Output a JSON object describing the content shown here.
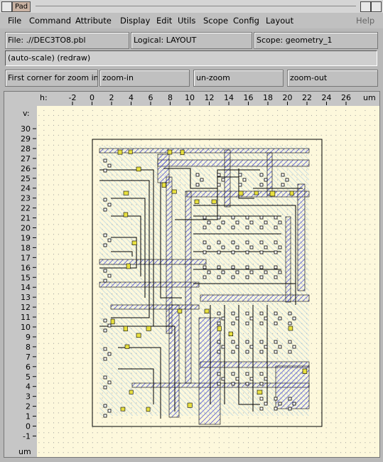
{
  "window": {
    "title": "Pad"
  },
  "menu": [
    "File",
    "Command",
    "Attribute",
    "Display",
    "Edit",
    "Utils",
    "Scope",
    "Config",
    "Layout",
    "Help"
  ],
  "info": {
    "file": "File: .//DEC3TO8.pbl",
    "logical": "Logical: LAYOUT",
    "scope": "Scope: geometry_1"
  },
  "command_line": "(auto-scale) (redraw)",
  "buttons": {
    "prompt": "First corner for zoom in",
    "zoom_in": "zoom-in",
    "un_zoom": "un-zoom",
    "zoom_out": "zoom-out"
  },
  "ruler": {
    "h_label": "h:",
    "v_label": "v:",
    "unit": "um",
    "x_ticks": [
      "-2",
      "0",
      "2",
      "4",
      "6",
      "8",
      "10",
      "12",
      "14",
      "16",
      "18",
      "20",
      "22",
      "24",
      "26"
    ],
    "y_ticks": [
      "30",
      "29",
      "28",
      "27",
      "26",
      "25",
      "24",
      "23",
      "22",
      "21",
      "20",
      "19",
      "18",
      "17",
      "16",
      "15",
      "14",
      "13",
      "12",
      "11",
      "10",
      "9",
      "8",
      "7",
      "6",
      "5",
      "4",
      "3",
      "2",
      "1",
      "0",
      "-1"
    ]
  },
  "colors": {
    "canvas_bg": "#fdf8dc",
    "grid_dot": "#9a9a9a",
    "metal_hatch": "#3a3ad0",
    "poly_hatch": "#9cc6e6",
    "contact": "#e8e040",
    "outline": "#000000"
  }
}
